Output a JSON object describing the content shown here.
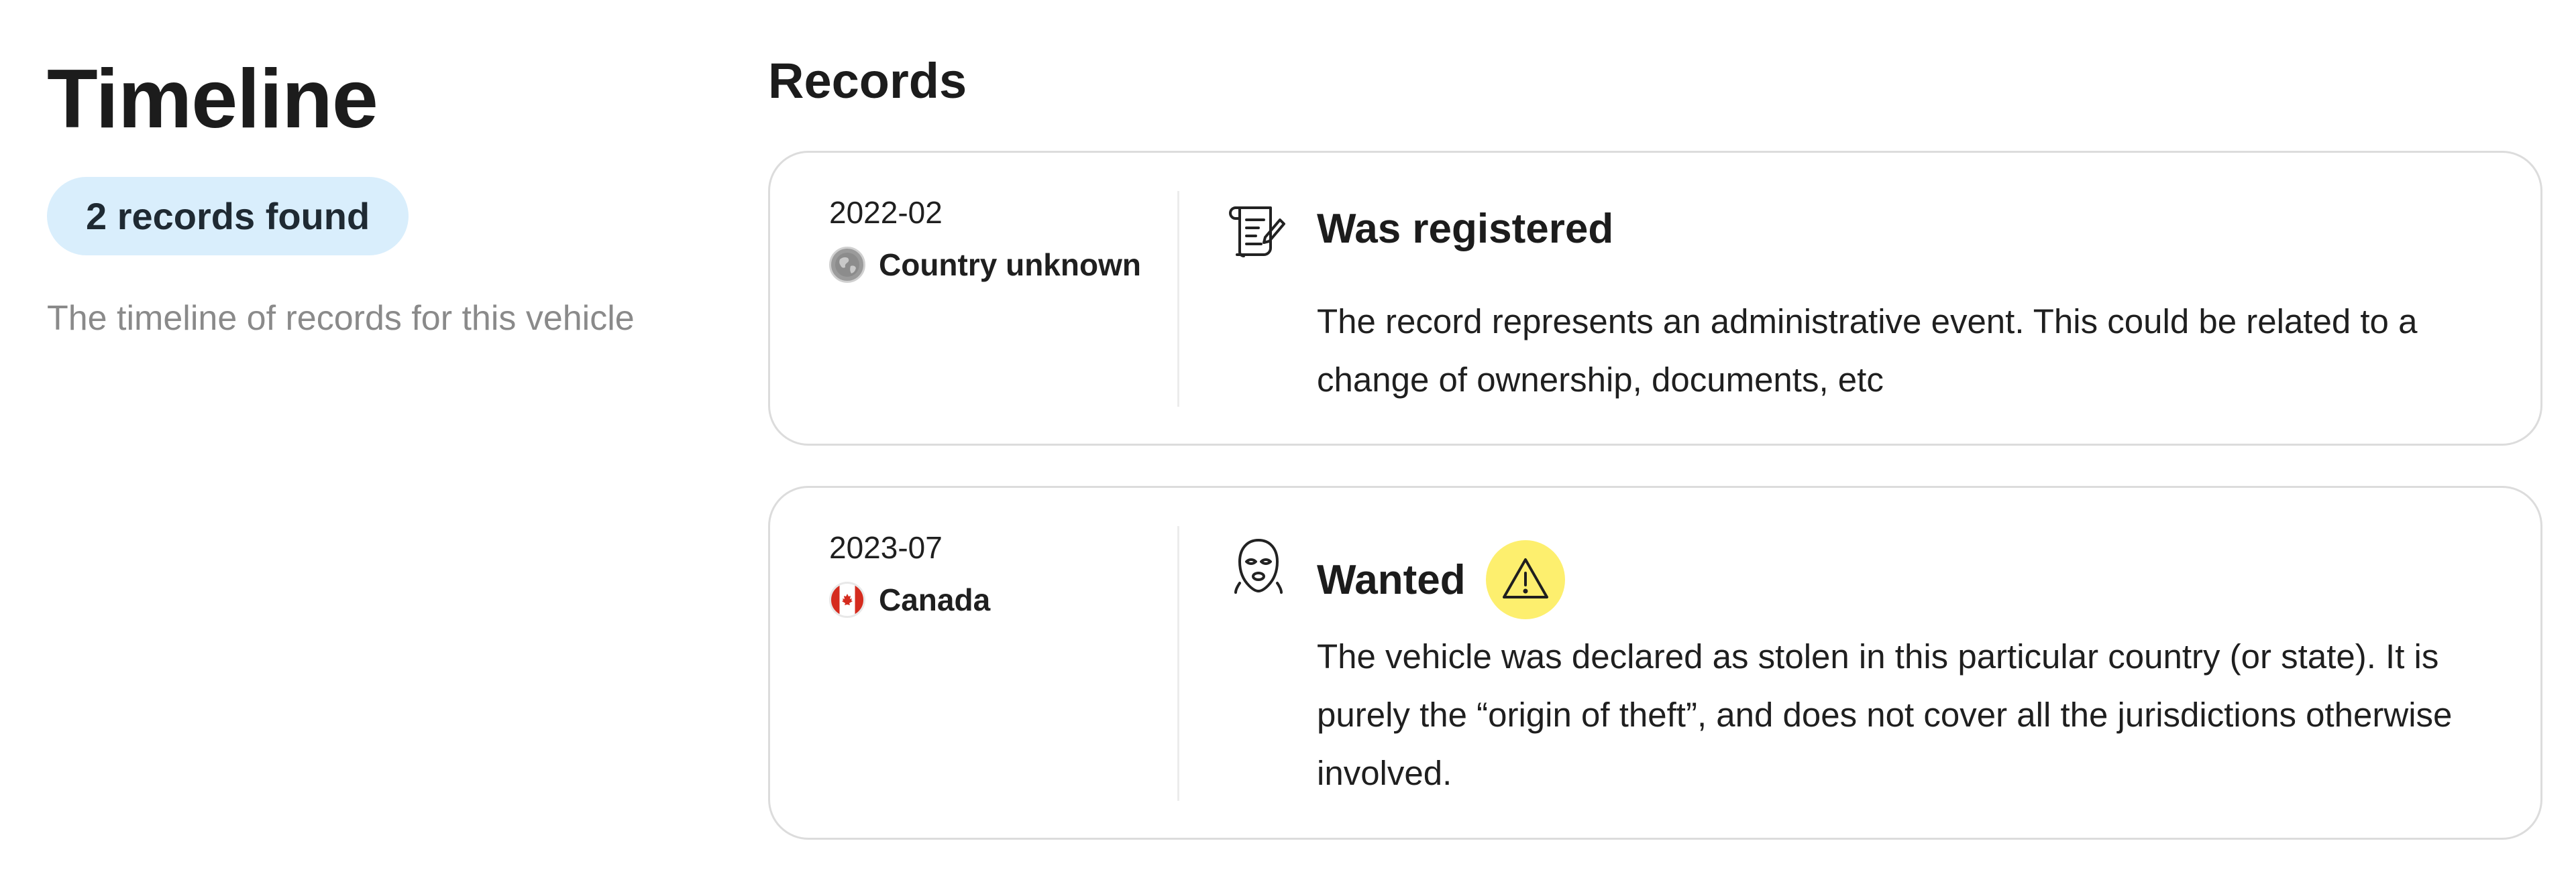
{
  "timeline": {
    "title": "Timeline",
    "badge": "2 records found",
    "description": "The timeline of records for this vehicle"
  },
  "records": {
    "title": "Records",
    "items": [
      {
        "date": "2022-02",
        "country": "Country unknown",
        "country_icon": "globe-icon",
        "icon": "registration-document-icon",
        "title": "Was registered",
        "description": "The record represents an administrative event. This could be related to a change of ownership, documents, etc"
      },
      {
        "date": "2023-07",
        "country": "Canada",
        "country_icon": "canada-flag-icon",
        "icon": "thief-mask-icon",
        "title": "Wanted",
        "warning_icon": "warning-icon",
        "description": "The vehicle was declared as stolen in this particular country (or state). It is purely the “origin of theft”, and does not cover all the jurisdictions otherwise involved."
      }
    ]
  },
  "colors": {
    "badge_background": "#d9eefc",
    "warning_background": "#fdef6e",
    "card_border": "#dcdcdc",
    "muted_text": "#8a8a8a"
  }
}
